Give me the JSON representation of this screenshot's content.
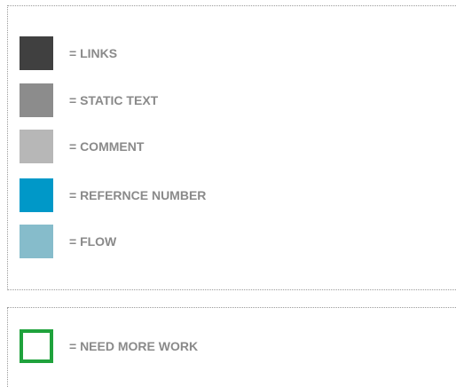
{
  "legend": {
    "items": [
      {
        "label": "= LINKS",
        "color": "#404040"
      },
      {
        "label": "= STATIC TEXT",
        "color": "#8c8c8c"
      },
      {
        "label": "= COMMENT",
        "color": "#b7b7b7"
      },
      {
        "label": "= REFERNCE NUMBER",
        "color": "#0098c8"
      },
      {
        "label": "= FLOW",
        "color": "#86bccb"
      }
    ],
    "work_item": {
      "label": "= NEED MORE WORK",
      "border_color": "#1fa23c"
    }
  }
}
